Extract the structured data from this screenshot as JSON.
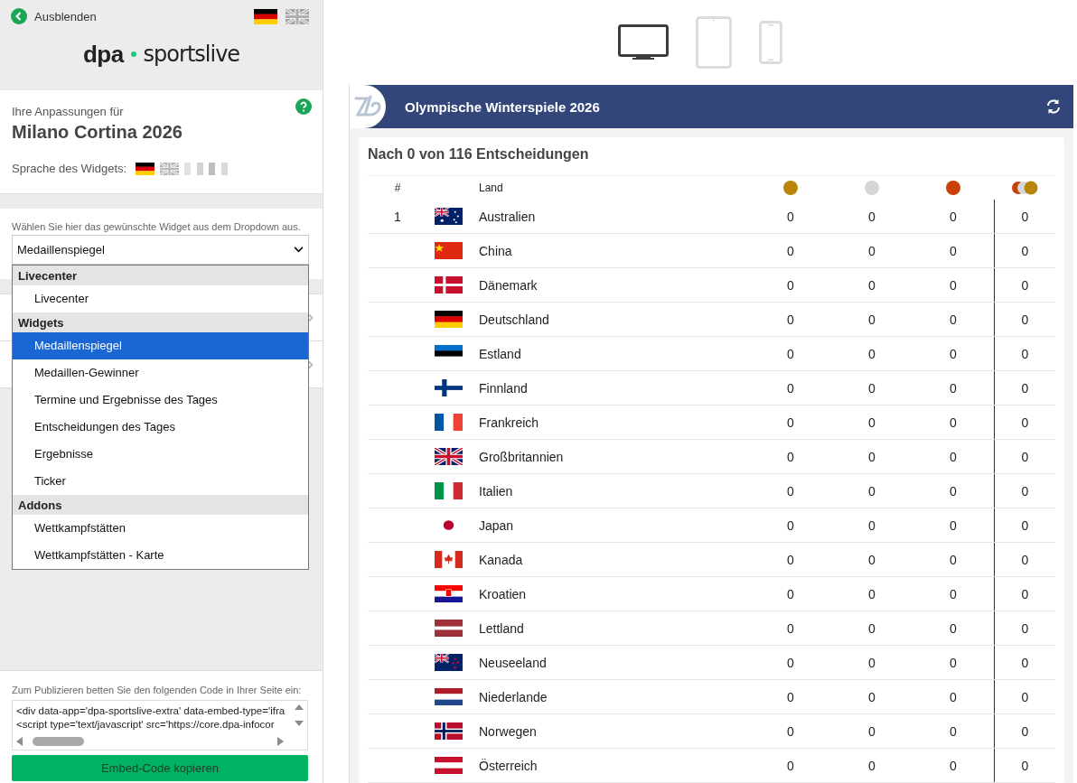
{
  "sidebar": {
    "hide_label": "Ausblenden",
    "ui_languages": [
      {
        "selected": true
      },
      {
        "selected": false
      }
    ],
    "logo": {
      "left": "dpa",
      "right": "sportslive"
    },
    "customize_label": "Ihre Anpassungen für",
    "event": "Milano Cortina 2026",
    "widget_language_label": "Sprache des Widgets:",
    "widget_languages": [
      {
        "selected": true
      },
      {
        "selected": false
      }
    ],
    "widget_hint": "Wählen Sie hier das gewünschte Widget aus dem Dropdown aus.",
    "widget_select": {
      "value": "Medaillenspiegel"
    },
    "dropdown": [
      {
        "group": "Livecenter",
        "items": [
          {
            "label": "Livecenter",
            "selected": false
          }
        ]
      },
      {
        "group": "Widgets",
        "items": [
          {
            "label": "Medaillenspiegel",
            "selected": true
          },
          {
            "label": "Medaillen-Gewinner",
            "selected": false
          },
          {
            "label": "Termine und Ergebnisse des Tages",
            "selected": false
          },
          {
            "label": "Entscheidungen des Tages",
            "selected": false
          },
          {
            "label": "Ergebnisse",
            "selected": false
          },
          {
            "label": "Ticker",
            "selected": false
          }
        ]
      },
      {
        "group": "Addons",
        "items": [
          {
            "label": "Wettkampfstätten",
            "selected": false
          },
          {
            "label": "Wettkampfstätten - Karte",
            "selected": false
          }
        ]
      }
    ],
    "embed_hint": "Zum Publizieren betten Sie den folgenden Code in Ihrer Seite ein:",
    "embed_code": [
      "<div data-app='dpa-sportslive-extra' data-embed-type='ifra",
      "<script type='text/javascript' src='https://core.dpa-infocor"
    ],
    "copy_button": "Embed-Code kopieren"
  },
  "devices": [
    {
      "kind": "desktop",
      "selected": true
    },
    {
      "kind": "tablet",
      "selected": false
    },
    {
      "kind": "phone",
      "selected": false
    }
  ],
  "widget": {
    "title": "Olympische Winterspiele 2026",
    "subtitle": "Nach 0 von 116 Entscheidungen",
    "columns": {
      "rank": "#",
      "country": "Land"
    },
    "rows": [
      {
        "rank": "1",
        "country": "Australien",
        "gold": "0",
        "silver": "0",
        "bronze": "0",
        "total": "0"
      },
      {
        "rank": "",
        "country": "China",
        "gold": "0",
        "silver": "0",
        "bronze": "0",
        "total": "0"
      },
      {
        "rank": "",
        "country": "Dänemark",
        "gold": "0",
        "silver": "0",
        "bronze": "0",
        "total": "0"
      },
      {
        "rank": "",
        "country": "Deutschland",
        "gold": "0",
        "silver": "0",
        "bronze": "0",
        "total": "0"
      },
      {
        "rank": "",
        "country": "Estland",
        "gold": "0",
        "silver": "0",
        "bronze": "0",
        "total": "0"
      },
      {
        "rank": "",
        "country": "Finnland",
        "gold": "0",
        "silver": "0",
        "bronze": "0",
        "total": "0"
      },
      {
        "rank": "",
        "country": "Frankreich",
        "gold": "0",
        "silver": "0",
        "bronze": "0",
        "total": "0"
      },
      {
        "rank": "",
        "country": "Großbritannien",
        "gold": "0",
        "silver": "0",
        "bronze": "0",
        "total": "0"
      },
      {
        "rank": "",
        "country": "Italien",
        "gold": "0",
        "silver": "0",
        "bronze": "0",
        "total": "0"
      },
      {
        "rank": "",
        "country": "Japan",
        "gold": "0",
        "silver": "0",
        "bronze": "0",
        "total": "0"
      },
      {
        "rank": "",
        "country": "Kanada",
        "gold": "0",
        "silver": "0",
        "bronze": "0",
        "total": "0"
      },
      {
        "rank": "",
        "country": "Kroatien",
        "gold": "0",
        "silver": "0",
        "bronze": "0",
        "total": "0"
      },
      {
        "rank": "",
        "country": "Lettland",
        "gold": "0",
        "silver": "0",
        "bronze": "0",
        "total": "0"
      },
      {
        "rank": "",
        "country": "Neuseeland",
        "gold": "0",
        "silver": "0",
        "bronze": "0",
        "total": "0"
      },
      {
        "rank": "",
        "country": "Niederlande",
        "gold": "0",
        "silver": "0",
        "bronze": "0",
        "total": "0"
      },
      {
        "rank": "",
        "country": "Norwegen",
        "gold": "0",
        "silver": "0",
        "bronze": "0",
        "total": "0"
      },
      {
        "rank": "",
        "country": "Österreich",
        "gold": "0",
        "silver": "0",
        "bronze": "0",
        "total": "0"
      }
    ]
  }
}
